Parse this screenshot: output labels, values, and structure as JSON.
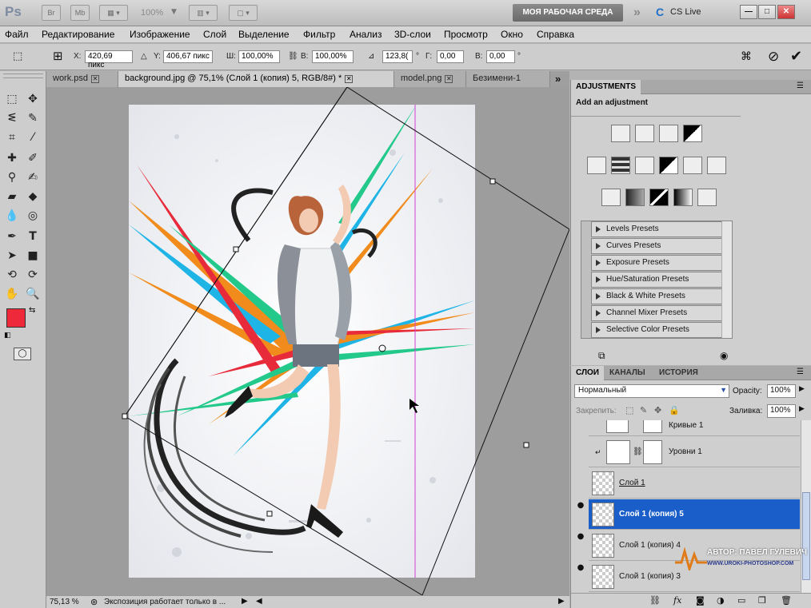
{
  "titlebar": {
    "app_logo": "Ps",
    "bridge_label": "Br",
    "mini_bridge_label": "Mb",
    "zoom": "100%",
    "workspace": "МОЯ РАБОЧАЯ СРЕДА",
    "extend": "»",
    "cs_live": "CS Live",
    "minimize": "—",
    "maximize": "□",
    "close": "✕"
  },
  "menu": [
    "Файл",
    "Редактирование",
    "Изображение",
    "Слой",
    "Выделение",
    "Фильтр",
    "Анализ",
    "3D-слои",
    "Просмотр",
    "Окно",
    "Справка"
  ],
  "options": {
    "x_label": "X:",
    "x_value": "420,69 пикс",
    "y_label": "Y:",
    "y_value": "406,67 пикс",
    "w_label": "Ш:",
    "w_value": "100,00%",
    "h_label": "В:",
    "h_value": "100,00%",
    "angle_value": "123,8(",
    "hskew_label": "Г:",
    "hskew_value": "0,00",
    "vskew_label": "В:",
    "vskew_value": "0,00",
    "deg1": "°",
    "deg2": "°"
  },
  "tabs": [
    {
      "label": "work.psd"
    },
    {
      "label": "background.jpg @ 75,1% (Слой 1 (копия) 5, RGB/8#) *"
    },
    {
      "label": "model.png"
    },
    {
      "label": "Безимени-1"
    }
  ],
  "tabs_more": "»",
  "status": {
    "zoom": "75,13 %",
    "message": "Экспозиция работает только в ..."
  },
  "adjustments": {
    "tab": "ADJUSTMENTS",
    "heading": "Add an adjustment",
    "presets": [
      "Levels Presets",
      "Curves Presets",
      "Exposure Presets",
      "Hue/Saturation Presets",
      "Black & White Presets",
      "Channel Mixer Presets",
      "Selective Color Presets"
    ]
  },
  "layers": {
    "tabs": [
      "СЛОИ",
      "КАНАЛЫ",
      "ИСТОРИЯ"
    ],
    "blend_mode": "Нормальный",
    "opacity_label": "Opacity:",
    "opacity_value": "100%",
    "lock_label": "Закрепить:",
    "fill_label": "Заливка:",
    "fill_value": "100%",
    "rows": [
      {
        "name": "Кривые 1"
      },
      {
        "name": "Уровни 1"
      },
      {
        "name": "Слой 1"
      },
      {
        "name": "Слой 1 (копия) 5"
      },
      {
        "name": "Слой 1 (копия) 4"
      },
      {
        "name": "Слой 1 (копия) 3"
      }
    ]
  },
  "watermark": {
    "author": "АВТОР: ПАВЕЛ ГУЛЕВИЧ",
    "site": "WWW.UROKI-PHOTOSHOP.COM"
  },
  "colors": {
    "foreground": "#ee2a3a",
    "background": "#ffffff",
    "selected_layer": "#1a5ec9"
  }
}
